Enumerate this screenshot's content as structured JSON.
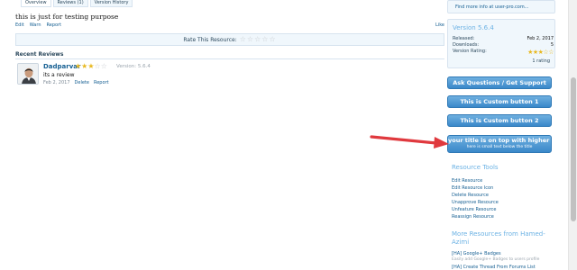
{
  "tabs": [
    {
      "label": "Overview"
    },
    {
      "label": "Reviews (1)"
    },
    {
      "label": "Version History"
    }
  ],
  "description": "this is just for testing purpose",
  "desc_actions": {
    "edit": "Edit",
    "warn": "Warn",
    "report": "Report"
  },
  "like": "Like",
  "rate": {
    "label": "Rate This Resource:",
    "stars": "☆☆☆☆☆"
  },
  "recent_reviews_title": "Recent Reviews",
  "review": {
    "author": "Dadparvar",
    "rating": 3,
    "stars_on": "★★★",
    "stars_off": "☆☆",
    "version": "Version: 5.6.4",
    "text": "its a review",
    "date": "Feb 2, 2017",
    "delete": "Delete",
    "report": "Report"
  },
  "sidebar": {
    "top_link": "Find more info at user-pro.com...",
    "version_heading": "Version 5.6.4",
    "stats": [
      {
        "label": "Released:",
        "value": "Feb 2, 2017"
      },
      {
        "label": "Downloads:",
        "value": "5"
      },
      {
        "label": "Version Rating:",
        "value": "★★★☆☆"
      }
    ],
    "rating_count": "1 rating",
    "buttons": [
      {
        "label": "Ask Questions / Get Support"
      },
      {
        "label": "This is Custom button 1"
      },
      {
        "label": "This is Custom button 2"
      }
    ],
    "big_button": {
      "label": "your title is on top with higher size",
      "sub": "here is small text below the title"
    },
    "tools_heading": "Resource Tools",
    "tools": [
      "Edit Resource",
      "Edit Resource Icon",
      "Delete Resource",
      "Unapprove Resource",
      "Unfeature Resource",
      "Reassign Resource"
    ],
    "more_heading": "More Resources from Hamed-Azimi",
    "more": [
      {
        "title": "[HA] Google+ Badges",
        "desc": "Easily add Google+ Badges to users profile"
      },
      {
        "title": "[HA] Create Thread From Forums List"
      }
    ]
  },
  "colors": {
    "accent": "#3a88c9",
    "link": "#176093",
    "heading": "#6cb2e4",
    "star": "#e8b81f",
    "arrow": "#e0393e"
  }
}
